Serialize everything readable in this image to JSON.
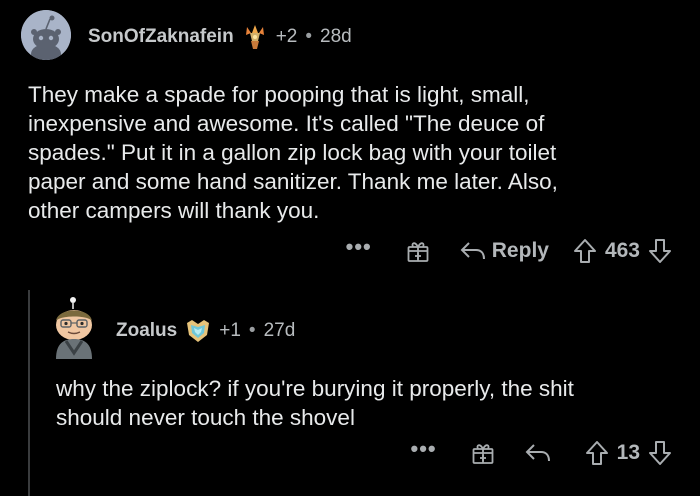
{
  "comments": [
    {
      "username": "SonOfZaknafein",
      "award_count": "+2",
      "separator": "•",
      "age": "28d",
      "body_lines": [
        "They make a spade for pooping that is light, small,",
        "inexpensive and awesome. It's called \"The deuce of",
        "spades.\" Put it in a gallon zip lock bag with your toilet",
        "paper and some hand sanitizer. Thank me later. Also,",
        "other campers will thank you."
      ],
      "more": "•••",
      "reply_label": "Reply",
      "score": "463",
      "flair_icon": "crystal-bouquet-icon"
    },
    {
      "username": "Zoalus",
      "award_count": "+1",
      "separator": "•",
      "age": "27d",
      "body_lines": [
        "why the ziplock? if you're burying it properly, the shit",
        "should never touch the shovel"
      ],
      "more": "•••",
      "score": "13",
      "flair_icon": "shield-gem-icon"
    }
  ],
  "colors": {
    "background": "#000000",
    "text": "#e8eaeb",
    "meta": "#b8bcbf",
    "thread_line": "#3a3c3e"
  }
}
